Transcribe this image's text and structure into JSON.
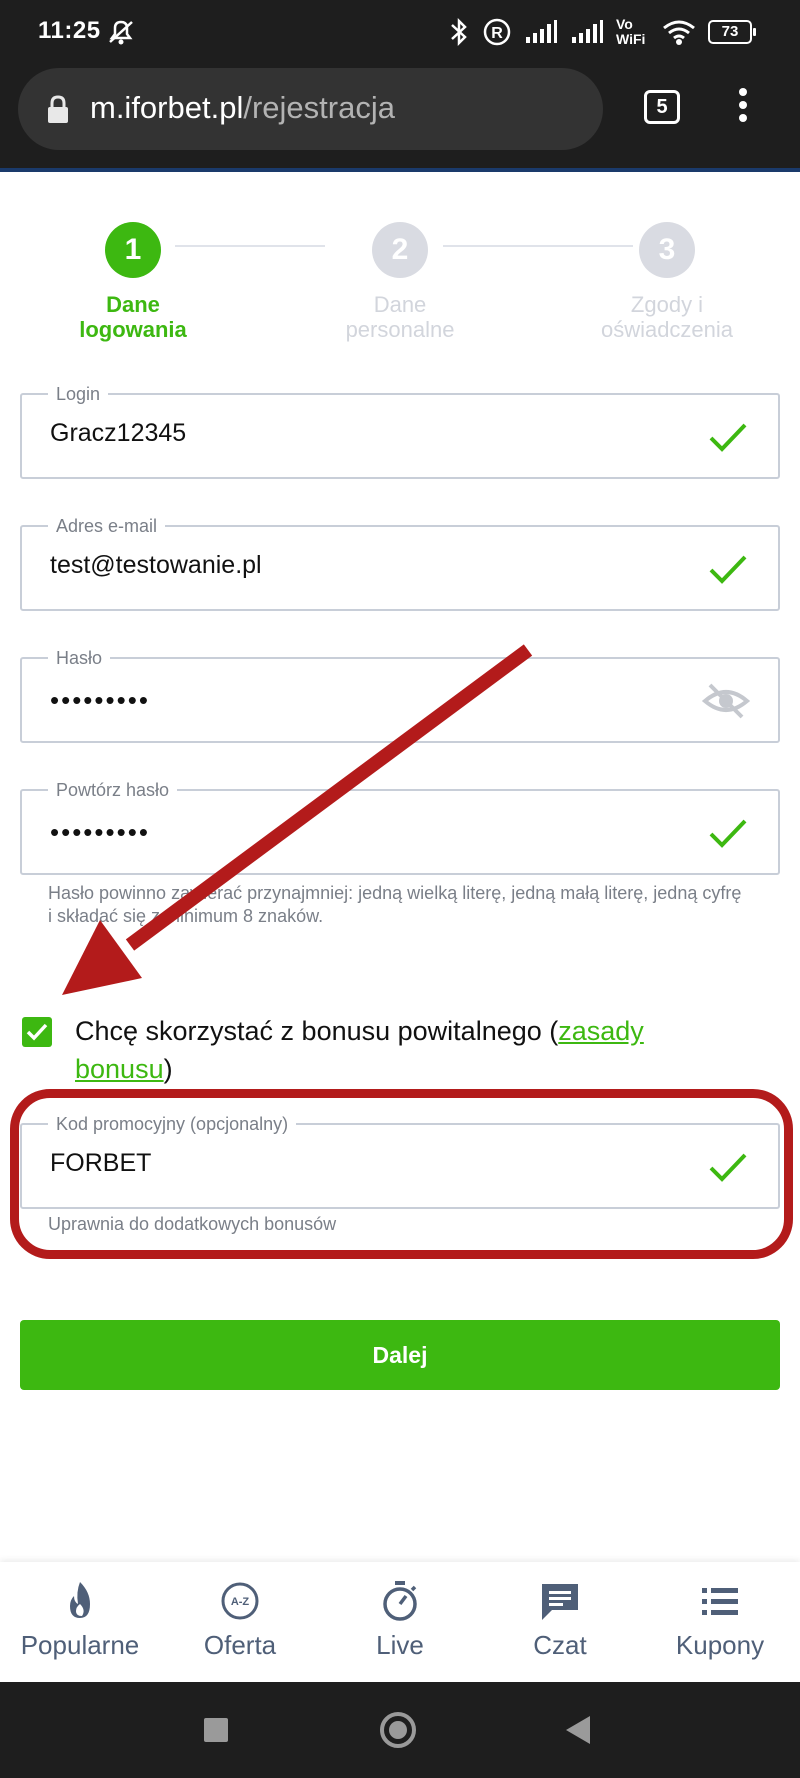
{
  "status_bar": {
    "time": "11:25",
    "battery": "73",
    "network_label": "Vo WiFi"
  },
  "browser": {
    "url_host": "m.iforbet.pl",
    "url_path": "/rejestracja",
    "tab_count": "5"
  },
  "stepper": {
    "steps": [
      {
        "number": "1",
        "label_line1": "Dane",
        "label_line2": "logowania",
        "active": true
      },
      {
        "number": "2",
        "label_line1": "Dane",
        "label_line2": "personalne",
        "active": false
      },
      {
        "number": "3",
        "label_line1": "Zgody i",
        "label_line2": "oświadczenia",
        "active": false
      }
    ]
  },
  "form": {
    "login": {
      "label": "Login",
      "value": "Gracz12345"
    },
    "email": {
      "label": "Adres e-mail",
      "value": "test@testowanie.pl"
    },
    "password": {
      "label": "Hasło",
      "value": "•••••••••"
    },
    "password_repeat": {
      "label": "Powtórz hasło",
      "value": "•••••••••"
    },
    "password_hint": "Hasło powinno zawierać przynajmniej: jedną wielką literę, jedną małą literę, jedną cyfrę i składać się z minimum 8 znaków.",
    "bonus_text": "Chcę skorzystać z bonusu powitalnego (",
    "bonus_link": "zasady bonusu",
    "bonus_close": ")",
    "promo": {
      "label": "Kod promocyjny (opcjonalny)",
      "value": "FORBET",
      "hint": "Uprawnia do dodatkowych bonusów"
    },
    "next_button": "Dalej"
  },
  "bottom_nav": [
    {
      "label": "Popularne",
      "icon": "flame-icon"
    },
    {
      "label": "Oferta",
      "icon": "az-icon"
    },
    {
      "label": "Live",
      "icon": "stopwatch-icon"
    },
    {
      "label": "Czat",
      "icon": "chat-icon"
    },
    {
      "label": "Kupony",
      "icon": "list-icon"
    }
  ],
  "colors": {
    "accent_green": "#3db811",
    "annotation_red": "#b31b1b",
    "nav_text": "#4f5f78"
  }
}
